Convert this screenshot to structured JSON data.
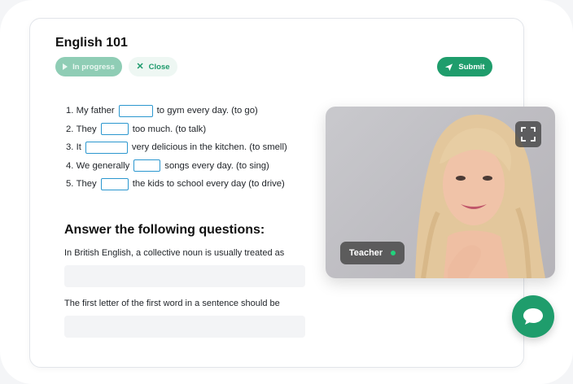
{
  "app": {
    "title": "English 101"
  },
  "toolbar": {
    "status_label": "In progress",
    "close_label": "Close",
    "submit_label": "Submit"
  },
  "exercise": {
    "items": [
      {
        "num": "1.",
        "before": "My father",
        "after": "to gym every day. (to go)"
      },
      {
        "num": "2.",
        "before": "They",
        "after": "too much. (to talk)"
      },
      {
        "num": "3.",
        "before": "It",
        "after": "very delicious in the kitchen. (to smell)"
      },
      {
        "num": "4.",
        "before": "We generally",
        "after": "songs every day. (to sing)"
      },
      {
        "num": "5.",
        "before": "They",
        "after": "the kids to school every day (to drive)"
      }
    ]
  },
  "questions": {
    "heading": "Answer the following questions:",
    "items": [
      {
        "text": "In British English, a collective noun is usually treated as",
        "value": ""
      },
      {
        "text": "The first letter of the first word in a sentence should be",
        "value": ""
      }
    ]
  },
  "video": {
    "tag_label": "Teacher",
    "status_color": "#22d27d"
  },
  "colors": {
    "accent": "#1f9d6c",
    "input_border": "#2b97cf"
  },
  "icons": {
    "status": "play-icon",
    "close": "x-icon",
    "submit": "send-icon",
    "expand": "fullscreen-icon",
    "chat": "chat-bubble-icon"
  }
}
